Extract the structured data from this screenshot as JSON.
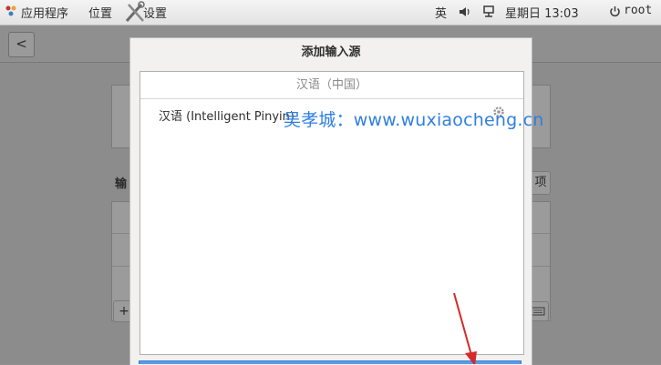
{
  "topbar": {
    "apps_label": "应用程序",
    "places_label": "位置",
    "settings_label": "设置",
    "input_method": "英",
    "clock": "星期日 13:03",
    "user": "root"
  },
  "background": {
    "back_button": "<",
    "input_sources_label": "输",
    "options_button": "项",
    "add_button": "+"
  },
  "dialog": {
    "title": "添加输入源",
    "group_header": "汉语（中国）",
    "row_label": "汉语 (Intelligent Pinyin)"
  },
  "watermark": "吴孝城：www.wuxiaocheng.cn",
  "colors": {
    "watermark": "#2f7fe0",
    "arrow": "#d42a2a"
  }
}
